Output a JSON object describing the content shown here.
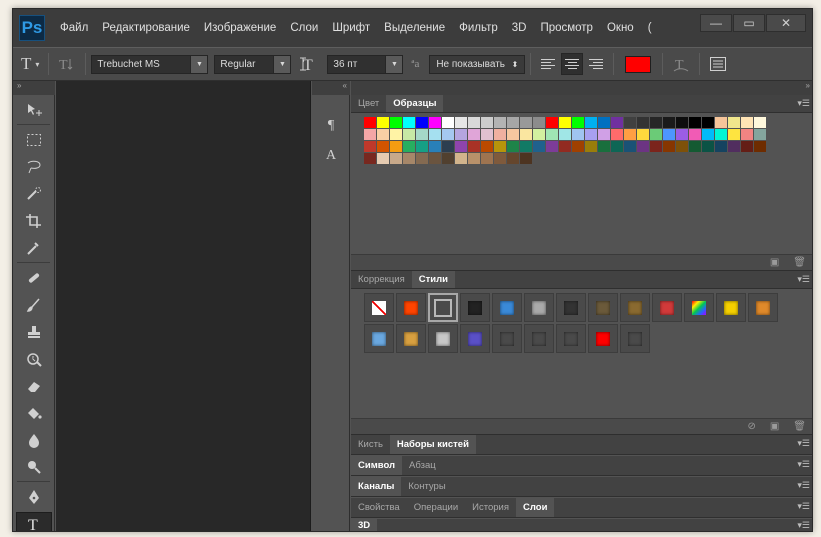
{
  "app": {
    "logo": "Ps"
  },
  "menu": [
    "Файл",
    "Редактирование",
    "Изображение",
    "Слои",
    "Шрифт",
    "Выделение",
    "Фильтр",
    "3D",
    "Просмотр",
    "Окно",
    "("
  ],
  "window_controls": {
    "minimize": "—",
    "maximize": "▭",
    "close": "✕"
  },
  "options": {
    "tool_icon": "T",
    "font_family": "Trebuchet MS",
    "font_style": "Regular",
    "font_size": "36 пт",
    "aa_icon": "ªa",
    "antialias": "Не показывать",
    "text_color": "#ff0000"
  },
  "tools": [
    "move-tool",
    "marquee-tool",
    "lasso-tool",
    "quick-select-tool",
    "crop-tool",
    "eyedropper-tool",
    "healing-brush-tool",
    "brush-tool",
    "clone-stamp-tool",
    "history-brush-tool",
    "eraser-tool",
    "paint-bucket-tool",
    "blur-tool",
    "dodge-tool",
    "pen-tool",
    "type-tool"
  ],
  "minidock": {
    "icon1": "¶",
    "icon2": "A"
  },
  "panels": {
    "swatches": {
      "tabs": [
        "Цвет",
        "Образцы"
      ],
      "active": 1
    },
    "adjust_styles": {
      "tabs": [
        "Коррекция",
        "Стили"
      ],
      "active": 1
    },
    "brushes": {
      "tabs": [
        "Кисть",
        "Наборы кистей"
      ],
      "active": 1
    },
    "character": {
      "tabs": [
        "Символ",
        "Абзац"
      ],
      "active": 0
    },
    "channels": {
      "tabs": [
        "Каналы",
        "Контуры"
      ],
      "active": 0
    },
    "layers": {
      "tabs": [
        "Свойства",
        "Операции",
        "История",
        "Слои"
      ],
      "active": 3
    },
    "threed": {
      "tabs": [
        "3D"
      ],
      "active": 0
    }
  },
  "swatch_rows": [
    [
      "#ff0000",
      "#ffff00",
      "#00ff00",
      "#00ffff",
      "#0000ff",
      "#ff00ff",
      "#ffffff",
      "#e6e6e6",
      "#d9d9d9",
      "#cccccc",
      "#b3b3b3",
      "#a6a6a6",
      "#999999",
      "#8c8c8c",
      "#ff0000",
      "#ffff00",
      "#00ff00",
      "#00b0f0",
      "#0070c0",
      "#7030a0",
      "#404040",
      "#333333",
      "#262626",
      "#1a1a1a",
      "#0d0d0d",
      "#000000",
      "#000000",
      "#f5c59a",
      "#f0e68c",
      "#ffe4b5",
      "#fff8dc"
    ],
    [
      "#f4a6a6",
      "#f9cfa5",
      "#fff3a5",
      "#c7e9a5",
      "#a5d8c8",
      "#a5e0f0",
      "#a5c8f0",
      "#b5a5e0",
      "#e0a5d8",
      "#e0c0d0",
      "#f0b0a0",
      "#f6c7a0",
      "#fae6a0",
      "#d2f0a0",
      "#a0e6b4",
      "#a0e6e6",
      "#a0c4f0",
      "#a8a0f0",
      "#d0a0e6",
      "#ff6b6b",
      "#ff9f43",
      "#ffd93d",
      "#6bcb77",
      "#4d96ff",
      "#9b5de5",
      "#f15bb5",
      "#00bbf9",
      "#00f5d4",
      "#fee440",
      "#f28482",
      "#84a59d"
    ],
    [
      "#c0392b",
      "#d35400",
      "#f39c12",
      "#27ae60",
      "#16a085",
      "#2980b9",
      "#2c3e50",
      "#8e44ad",
      "#a93226",
      "#ba4a00",
      "#b7950b",
      "#1e8449",
      "#117a65",
      "#1f618d",
      "#7d3c98",
      "#922b21",
      "#a04000",
      "#9a7d0a",
      "#196f3d",
      "#0e6655",
      "#1a5276",
      "#6c3483",
      "#7b241c",
      "#873600",
      "#7e5109",
      "#145a32",
      "#0b5345",
      "#154360",
      "#512e5f",
      "#641e16",
      "#6e2c00"
    ],
    [
      "#78281f",
      "#e5cbb1",
      "#c8a98a",
      "#a68769",
      "#846a51",
      "#6a543f",
      "#51402f",
      "#d2b48c",
      "#b8916a",
      "#9e7450",
      "#7f5a3c",
      "#65462d",
      "#4d3421"
    ]
  ],
  "styles": [
    {
      "fx": "none"
    },
    {
      "fx": "#ff4400"
    },
    {
      "fx": "selected"
    },
    {
      "fx": "#222222"
    },
    {
      "fx": "#3a8ad8"
    },
    {
      "fx": "#aaaaaa"
    },
    {
      "fx": "#333333"
    },
    {
      "fx": "#6b5a3a"
    },
    {
      "fx": "#8a6a30"
    },
    {
      "fx": "#d23a3a"
    },
    {
      "fx": "rainbow"
    },
    {
      "fx": "#f5d000"
    },
    {
      "fx": "#e08a2a"
    },
    {
      "fx": "#6aa8e0"
    },
    {
      "fx": "#d8a040"
    },
    {
      "fx": "#c8c8c8"
    },
    {
      "fx": "#5a50c8"
    },
    {
      "fx": "#4a4a4a"
    },
    {
      "fx": "#4a4a4a"
    },
    {
      "fx": "#4a4a4a"
    },
    {
      "fx": "#ff0000"
    },
    {
      "fx": "#4a4a4a"
    }
  ]
}
